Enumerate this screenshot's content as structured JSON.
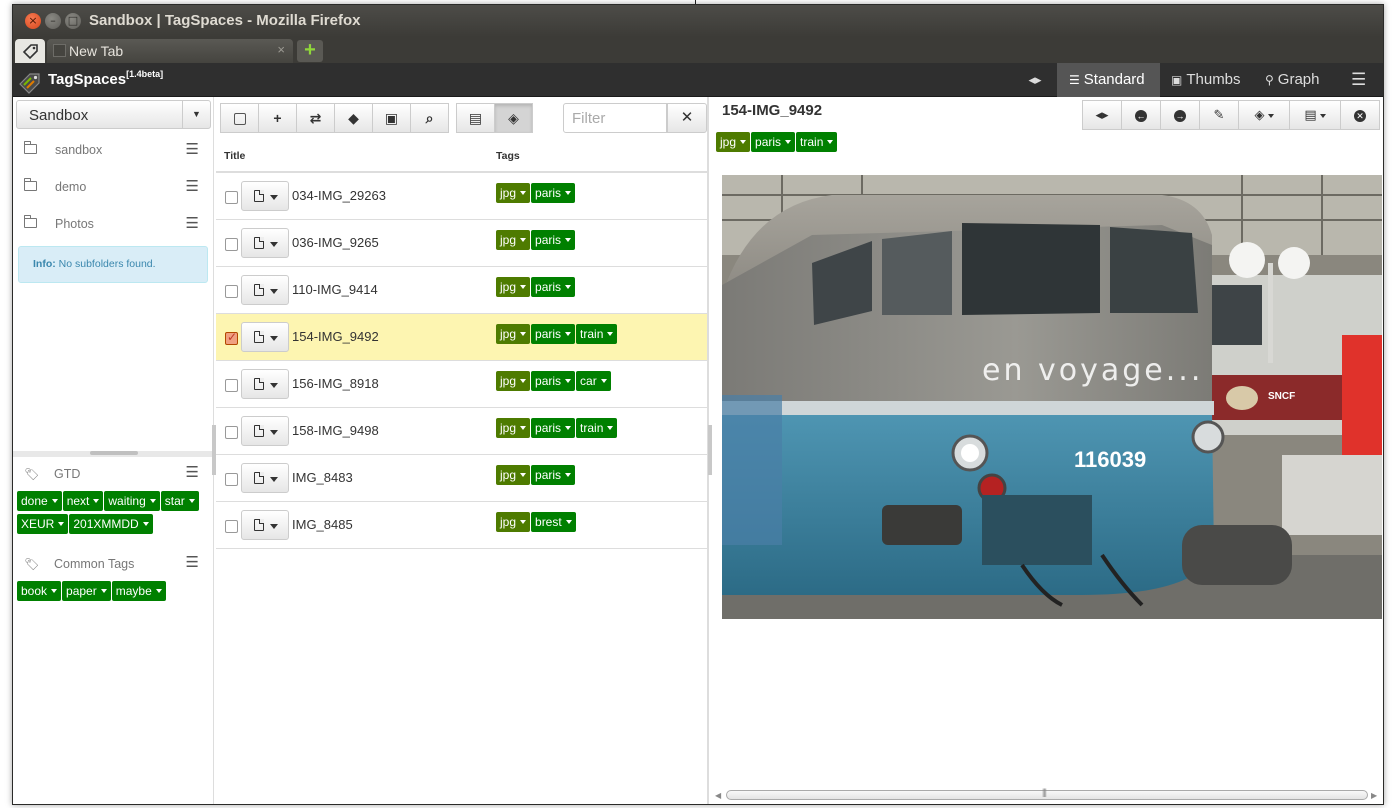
{
  "window": {
    "title": "Sandbox | TagSpaces - Mozilla Firefox"
  },
  "browser": {
    "tab_label": "New Tab",
    "tab_close": "×",
    "new_tab": "+"
  },
  "app": {
    "name": "TagSpaces",
    "version": "[1.4beta]",
    "nav": {
      "standard": "Standard",
      "thumbs": "Thumbs",
      "graph": "Graph"
    }
  },
  "sidebar": {
    "location": "Sandbox",
    "folders": [
      {
        "label": "sandbox"
      },
      {
        "label": "demo"
      },
      {
        "label": "Photos"
      }
    ],
    "info_prefix": "Info:",
    "info_text": " No subfolders found.",
    "tag_groups": [
      {
        "title": "GTD",
        "tags": [
          "done",
          "next",
          "waiting",
          "star",
          "XEUR",
          "201XMMDD"
        ]
      },
      {
        "title": "Common Tags",
        "tags": [
          "book",
          "paper",
          "maybe"
        ]
      }
    ]
  },
  "filelist": {
    "filter_placeholder": "Filter",
    "columns": {
      "title": "Title",
      "tags": "Tags"
    },
    "files": [
      {
        "name": "034-IMG_29263",
        "tags": [
          "jpg",
          "paris"
        ],
        "selected": false
      },
      {
        "name": "036-IMG_9265",
        "tags": [
          "jpg",
          "paris"
        ],
        "selected": false
      },
      {
        "name": "110-IMG_9414",
        "tags": [
          "jpg",
          "paris"
        ],
        "selected": false
      },
      {
        "name": "154-IMG_9492",
        "tags": [
          "jpg",
          "paris",
          "train"
        ],
        "selected": true
      },
      {
        "name": "156-IMG_8918",
        "tags": [
          "jpg",
          "paris",
          "car"
        ],
        "selected": false
      },
      {
        "name": "158-IMG_9498",
        "tags": [
          "jpg",
          "paris",
          "train"
        ],
        "selected": false
      },
      {
        "name": "IMG_8483",
        "tags": [
          "jpg",
          "paris"
        ],
        "selected": false
      },
      {
        "name": "IMG_8485",
        "tags": [
          "jpg",
          "brest"
        ],
        "selected": false
      }
    ]
  },
  "preview": {
    "title": "154-IMG_9492",
    "tags": [
      "jpg",
      "paris",
      "train"
    ],
    "image_text": "en voyage...",
    "loco_number": "116039",
    "logo_text": "SNCF"
  },
  "colors": {
    "tag_green": "#008000",
    "tag_olive": "#4e7b00",
    "navbar": "#2f2f2f",
    "selected_row": "#fdf5b1"
  }
}
